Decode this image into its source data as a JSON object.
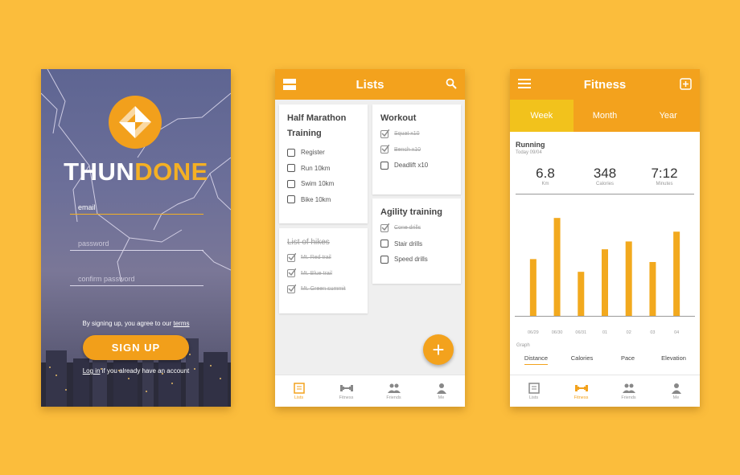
{
  "colors": {
    "background": "#fbbd3c",
    "accent": "#f3a21d",
    "accent_light": "#f2c21c",
    "bars": "#f2a91e"
  },
  "login": {
    "brand_part1": "THUN",
    "brand_part2": "DONE",
    "email_placeholder": "email",
    "password_placeholder": "password",
    "confirm_placeholder": "confirm password",
    "terms_text": "By signing up, you agree to our",
    "terms_link": "terms",
    "signup_label": "SIGN UP",
    "login_link": "Log in",
    "login_text": "if you already have an account"
  },
  "lists": {
    "title": "Lists",
    "cards": {
      "half_marathon": {
        "title": "Half Marathon Training",
        "items": [
          {
            "label": "Register",
            "done": false
          },
          {
            "label": "Run 10km",
            "done": false
          },
          {
            "label": "Swim 10km",
            "done": false
          },
          {
            "label": "Bike 10km",
            "done": false
          }
        ]
      },
      "workout": {
        "title": "Workout",
        "items": [
          {
            "label": "Squat x10",
            "done": true
          },
          {
            "label": "Bench x10",
            "done": true
          },
          {
            "label": "Deadlift x10",
            "done": false
          }
        ]
      },
      "hikes": {
        "title": "List of hikes",
        "items": [
          {
            "label": "Mt. Red trail",
            "done": true
          },
          {
            "label": "Mt. Blue trail",
            "done": true
          },
          {
            "label": "Mt. Green summit",
            "done": true
          }
        ]
      },
      "agility": {
        "title": "Agility training",
        "items": [
          {
            "label": "Cone drills",
            "done": true
          },
          {
            "label": "Stair drills",
            "done": false
          },
          {
            "label": "Speed drills",
            "done": false
          }
        ]
      }
    }
  },
  "nav": {
    "lists": "Lists",
    "fitness": "Fitness",
    "friends": "Friends",
    "me": "Me"
  },
  "fitness": {
    "title": "Fitness",
    "tabs": {
      "week": "Week",
      "month": "Month",
      "year": "Year"
    },
    "activity": "Running",
    "date": "Today 09/04",
    "stats": {
      "distance_value": "6.8",
      "distance_unit": "Km",
      "calories_value": "348",
      "calories_unit": "Calories",
      "time_value": "7:12",
      "time_unit": "Minutes"
    },
    "graph_label": "Graph",
    "metrics": {
      "distance": "Distance",
      "calories": "Calories",
      "pace": "Pace",
      "elevation": "Elevation"
    },
    "chart_data": {
      "type": "bar",
      "categories": [
        "06/29",
        "06/30",
        "06/31",
        "01",
        "02",
        "03",
        "04"
      ],
      "values": [
        5.8,
        10,
        4.5,
        6.8,
        7.6,
        5.5,
        8.6
      ],
      "title": "",
      "xlabel": "",
      "ylabel": "",
      "ylim": [
        0,
        11
      ],
      "grid": false
    }
  }
}
